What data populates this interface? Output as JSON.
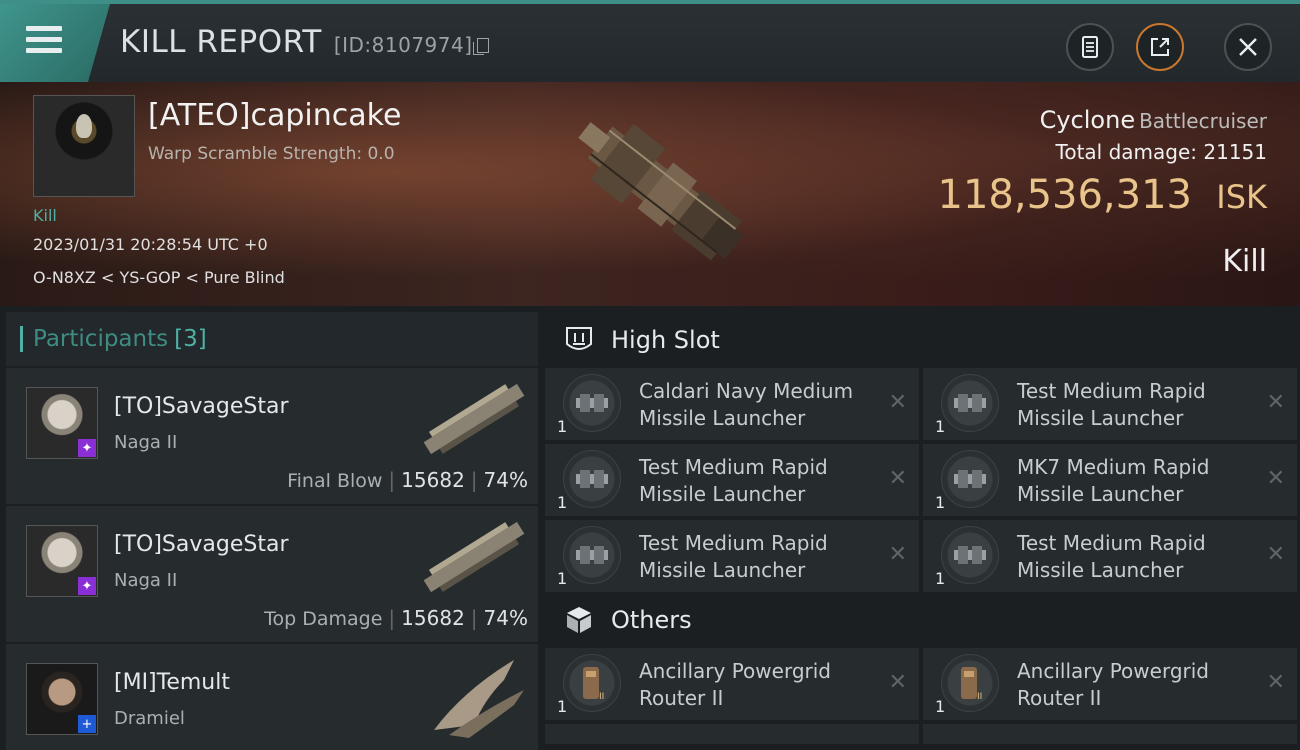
{
  "header": {
    "title": "KILL REPORT",
    "report_id": "[ID:8107974]"
  },
  "victim": {
    "name": "[ATEO]capincake",
    "warp_scramble": "Warp Scramble Strength: 0.0",
    "tag": "Kill",
    "datetime": "2023/01/31 20:28:54 UTC +0",
    "location": "O-N8XZ < YS-GOP < Pure Blind",
    "ship_name": "Cyclone",
    "ship_class": "Battlecruiser",
    "total_damage_label": "Total damage:",
    "total_damage_value": "21151",
    "isk_value": "118,536,313",
    "isk_unit": "ISK",
    "status": "Kill"
  },
  "participants": {
    "title": "Participants",
    "count": "[3]",
    "rows": [
      {
        "name": "[TO]SavageStar",
        "ship": "Naga II",
        "label": "Final Blow",
        "damage": "15682",
        "percent": "74%",
        "badge_color": "#8a2fd6"
      },
      {
        "name": "[TO]SavageStar",
        "ship": "Naga II",
        "label": "Top Damage",
        "damage": "15682",
        "percent": "74%",
        "badge_color": "#8a2fd6"
      },
      {
        "name": "[MI]Temult",
        "ship": "Dramiel",
        "label": "",
        "damage": "",
        "percent": "",
        "badge_color": "#1e5ad6"
      }
    ]
  },
  "high_slot": {
    "title": "High Slot",
    "items": [
      {
        "name": "Caldari Navy Medium Missile Launcher",
        "qty": "1"
      },
      {
        "name": "Test Medium Rapid Missile Launcher",
        "qty": "1"
      },
      {
        "name": "Test Medium Rapid Missile Launcher",
        "qty": "1"
      },
      {
        "name": "MK7 Medium Rapid Missile Launcher",
        "qty": "1"
      },
      {
        "name": "Test Medium Rapid Missile Launcher",
        "qty": "1"
      },
      {
        "name": "Test Medium Rapid Missile Launcher",
        "qty": "1"
      }
    ]
  },
  "others": {
    "title": "Others",
    "items": [
      {
        "name": "Ancillary Powergrid Router II",
        "qty": "1"
      },
      {
        "name": "Ancillary Powergrid Router II",
        "qty": "1"
      }
    ]
  },
  "icons": {
    "menu": "menu-icon",
    "copy": "copy-icon",
    "clipboard": "clipboard-icon",
    "share": "share-icon",
    "close": "close-icon",
    "high_slot": "high-slot-icon",
    "others": "cube-icon",
    "remove": "remove-x-icon"
  },
  "colors": {
    "accent": "#4fb0a3",
    "isk": "#e8c48a",
    "share_ring": "#c8782e"
  }
}
